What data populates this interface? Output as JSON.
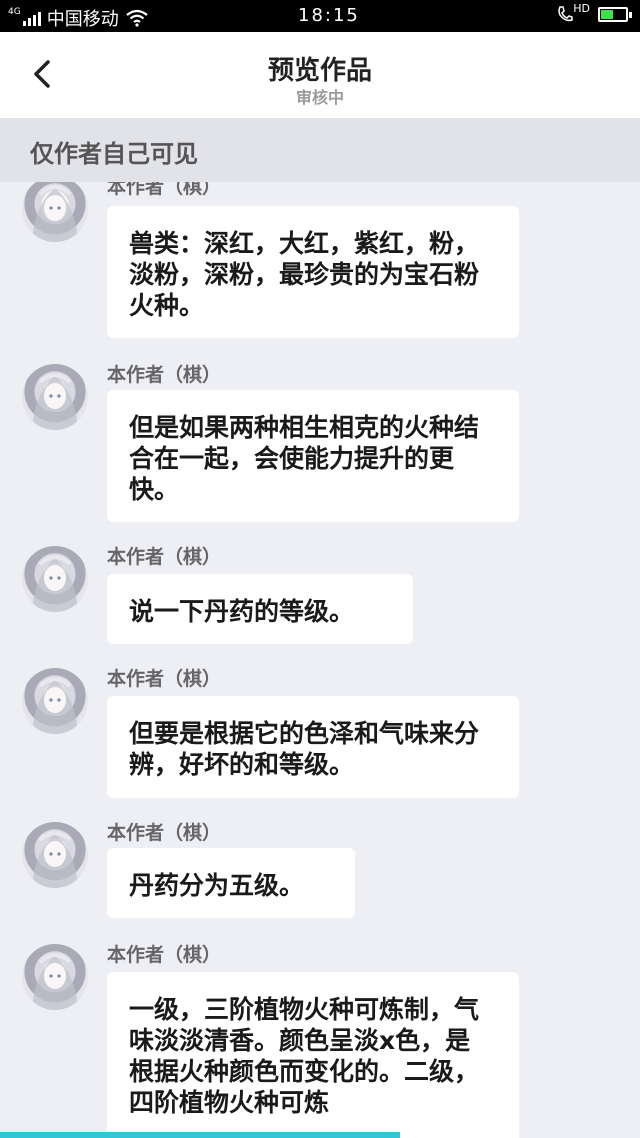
{
  "status_bar": {
    "network": "4G",
    "carrier": "中国移动",
    "time": "18:15",
    "hd_label": "HD"
  },
  "header": {
    "title": "预览作品",
    "subtitle": "审核中"
  },
  "notice": "仅作者自己可见",
  "messages": [
    {
      "author": "本作者（棋）",
      "text": "兽类：深红，大红，紫红，粉，淡粉，深粉，最珍贵的为宝石粉火种。"
    },
    {
      "author": "本作者（棋）",
      "text": "但是如果两种相生相克的火种结合在一起，会使能力提升的更快。"
    },
    {
      "author": "本作者（棋）",
      "text": "说一下丹药的等级。"
    },
    {
      "author": "本作者（棋）",
      "text": "但要是根据它的色泽和气味来分辨，好坏的和等级。"
    },
    {
      "author": "本作者（棋）",
      "text": "丹药分为五级。"
    },
    {
      "author": "本作者（棋）",
      "text": "一级，三阶植物火种可炼制，气味淡淡清香。颜色呈淡x色，是根据火种颜色而变化的。二级，四阶植物火种可炼"
    }
  ],
  "colors": {
    "background": "#eeeff4",
    "accent": "#30c6d6",
    "battery": "#3fe04a"
  }
}
